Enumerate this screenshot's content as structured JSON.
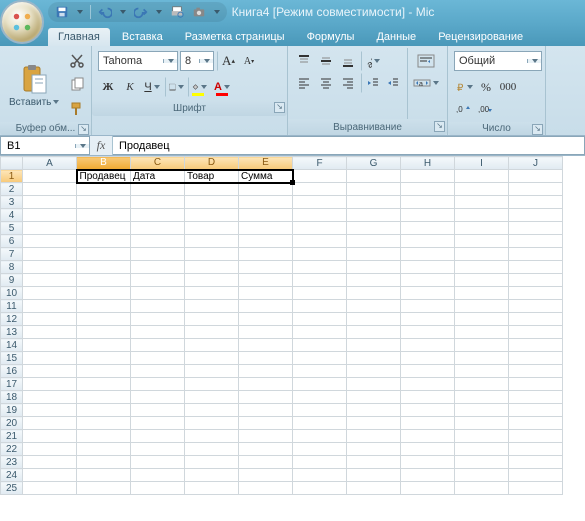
{
  "titlebar": {
    "title": "Книга4  [Режим совместимости] - Mic"
  },
  "qat": {
    "save": "save-icon",
    "undo": "undo-icon",
    "redo": "redo-icon",
    "print": "print-icon",
    "camera": "camera-icon"
  },
  "tabs": [
    {
      "label": "Главная",
      "active": true
    },
    {
      "label": "Вставка",
      "active": false
    },
    {
      "label": "Разметка страницы",
      "active": false
    },
    {
      "label": "Формулы",
      "active": false
    },
    {
      "label": "Данные",
      "active": false
    },
    {
      "label": "Рецензирование",
      "active": false
    }
  ],
  "ribbon": {
    "clipboard": {
      "label": "Буфер обм...",
      "paste": "Вставить"
    },
    "font": {
      "label": "Шрифт",
      "font_name": "Tahoma",
      "font_size": "8",
      "bold": "Ж",
      "italic": "К",
      "underline": "Ч"
    },
    "alignment": {
      "label": "Выравнивание"
    },
    "number": {
      "label": "Число",
      "format": "Общий"
    }
  },
  "namebox": {
    "value": "B1"
  },
  "formula_bar": {
    "fx": "fx",
    "value": "Продавец"
  },
  "grid": {
    "columns": [
      "A",
      "B",
      "C",
      "D",
      "E",
      "F",
      "G",
      "H",
      "I",
      "J"
    ],
    "rows": 25,
    "selected_cols": [
      "B",
      "C",
      "D",
      "E"
    ],
    "active_col": "B",
    "selected_row": 1,
    "cells": {
      "B1": "Продавец",
      "C1": "Дата",
      "D1": "Товар",
      "E1": "Сумма"
    }
  }
}
